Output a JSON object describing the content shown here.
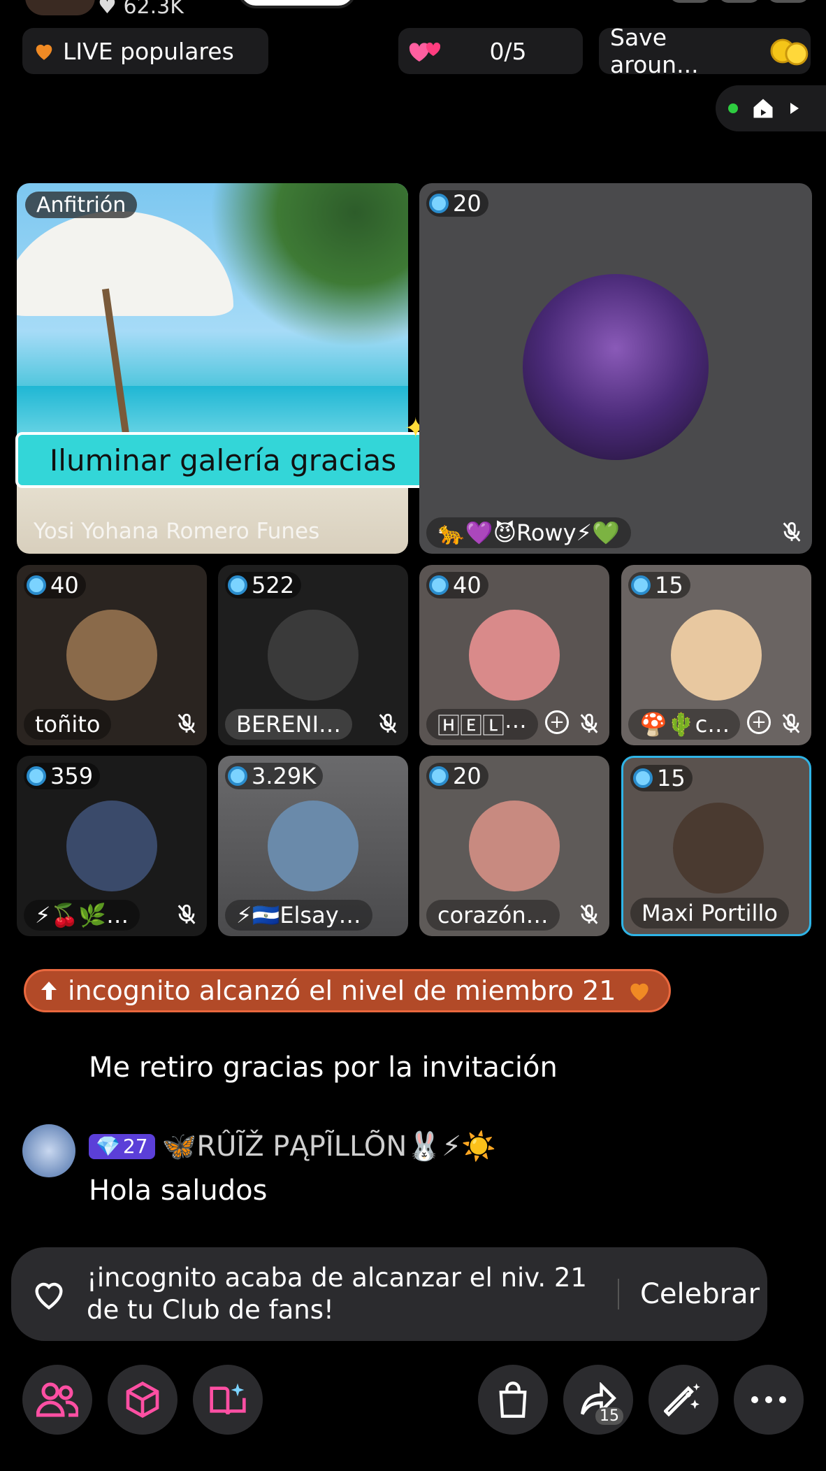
{
  "top_partial": {
    "likes": "62.3K"
  },
  "top_pills": {
    "popular_label": "LIVE populares",
    "counter": "0/5",
    "save_label": "Save aroun..."
  },
  "host_tile": {
    "role_label": "Anfitrión",
    "cta": "Iluminar galería gracias",
    "name": "Yosi Yohana Romero Funes"
  },
  "guest_main": {
    "score": "20",
    "name": "🐆💜😈Rowy⚡💚"
  },
  "guests": [
    {
      "score": "40",
      "name": "toñito",
      "avatar_color": "#8a6a4a"
    },
    {
      "score": "522",
      "name": "BERENI…",
      "avatar_color": "#3a3a3a"
    },
    {
      "score": "40",
      "name": "🄷🄴🄻⋯",
      "avatar_color": "#d98a8a"
    },
    {
      "score": "15",
      "name": "🍄🌵c…",
      "avatar_color": "#e8c8a0"
    },
    {
      "score": "359",
      "name": "⚡🍒🌿…",
      "avatar_color": "#3a4a6a"
    },
    {
      "score": "3.29K",
      "name": "⚡🇸🇻Elsay…",
      "avatar_color": "#6a8aaa"
    },
    {
      "score": "20",
      "name": "corazón…",
      "avatar_color": "#c88a80"
    },
    {
      "score": "15",
      "name": "Maxi Portillo",
      "avatar_color": "#4a3a30"
    }
  ],
  "chat": {
    "notice": "incognito alcanzó el nivel de miembro 21",
    "message1": "Me retiro gracias por la invitación",
    "user_level": "27",
    "username": "🦋RÛĨŽ PĄPĨLLÕN🐰⚡☀️",
    "message2": "Hola saludos"
  },
  "celebrate": {
    "text": "¡incognito acaba de alcanzar el niv. 21 de tu Club de fans!",
    "button": "Celebrar"
  },
  "bottom_nav": {
    "share_count": "15"
  },
  "colors": {
    "accent_cyan": "#33d6d8",
    "notice_bg": "#b24a28",
    "level_badge": "#5b3fd8"
  }
}
